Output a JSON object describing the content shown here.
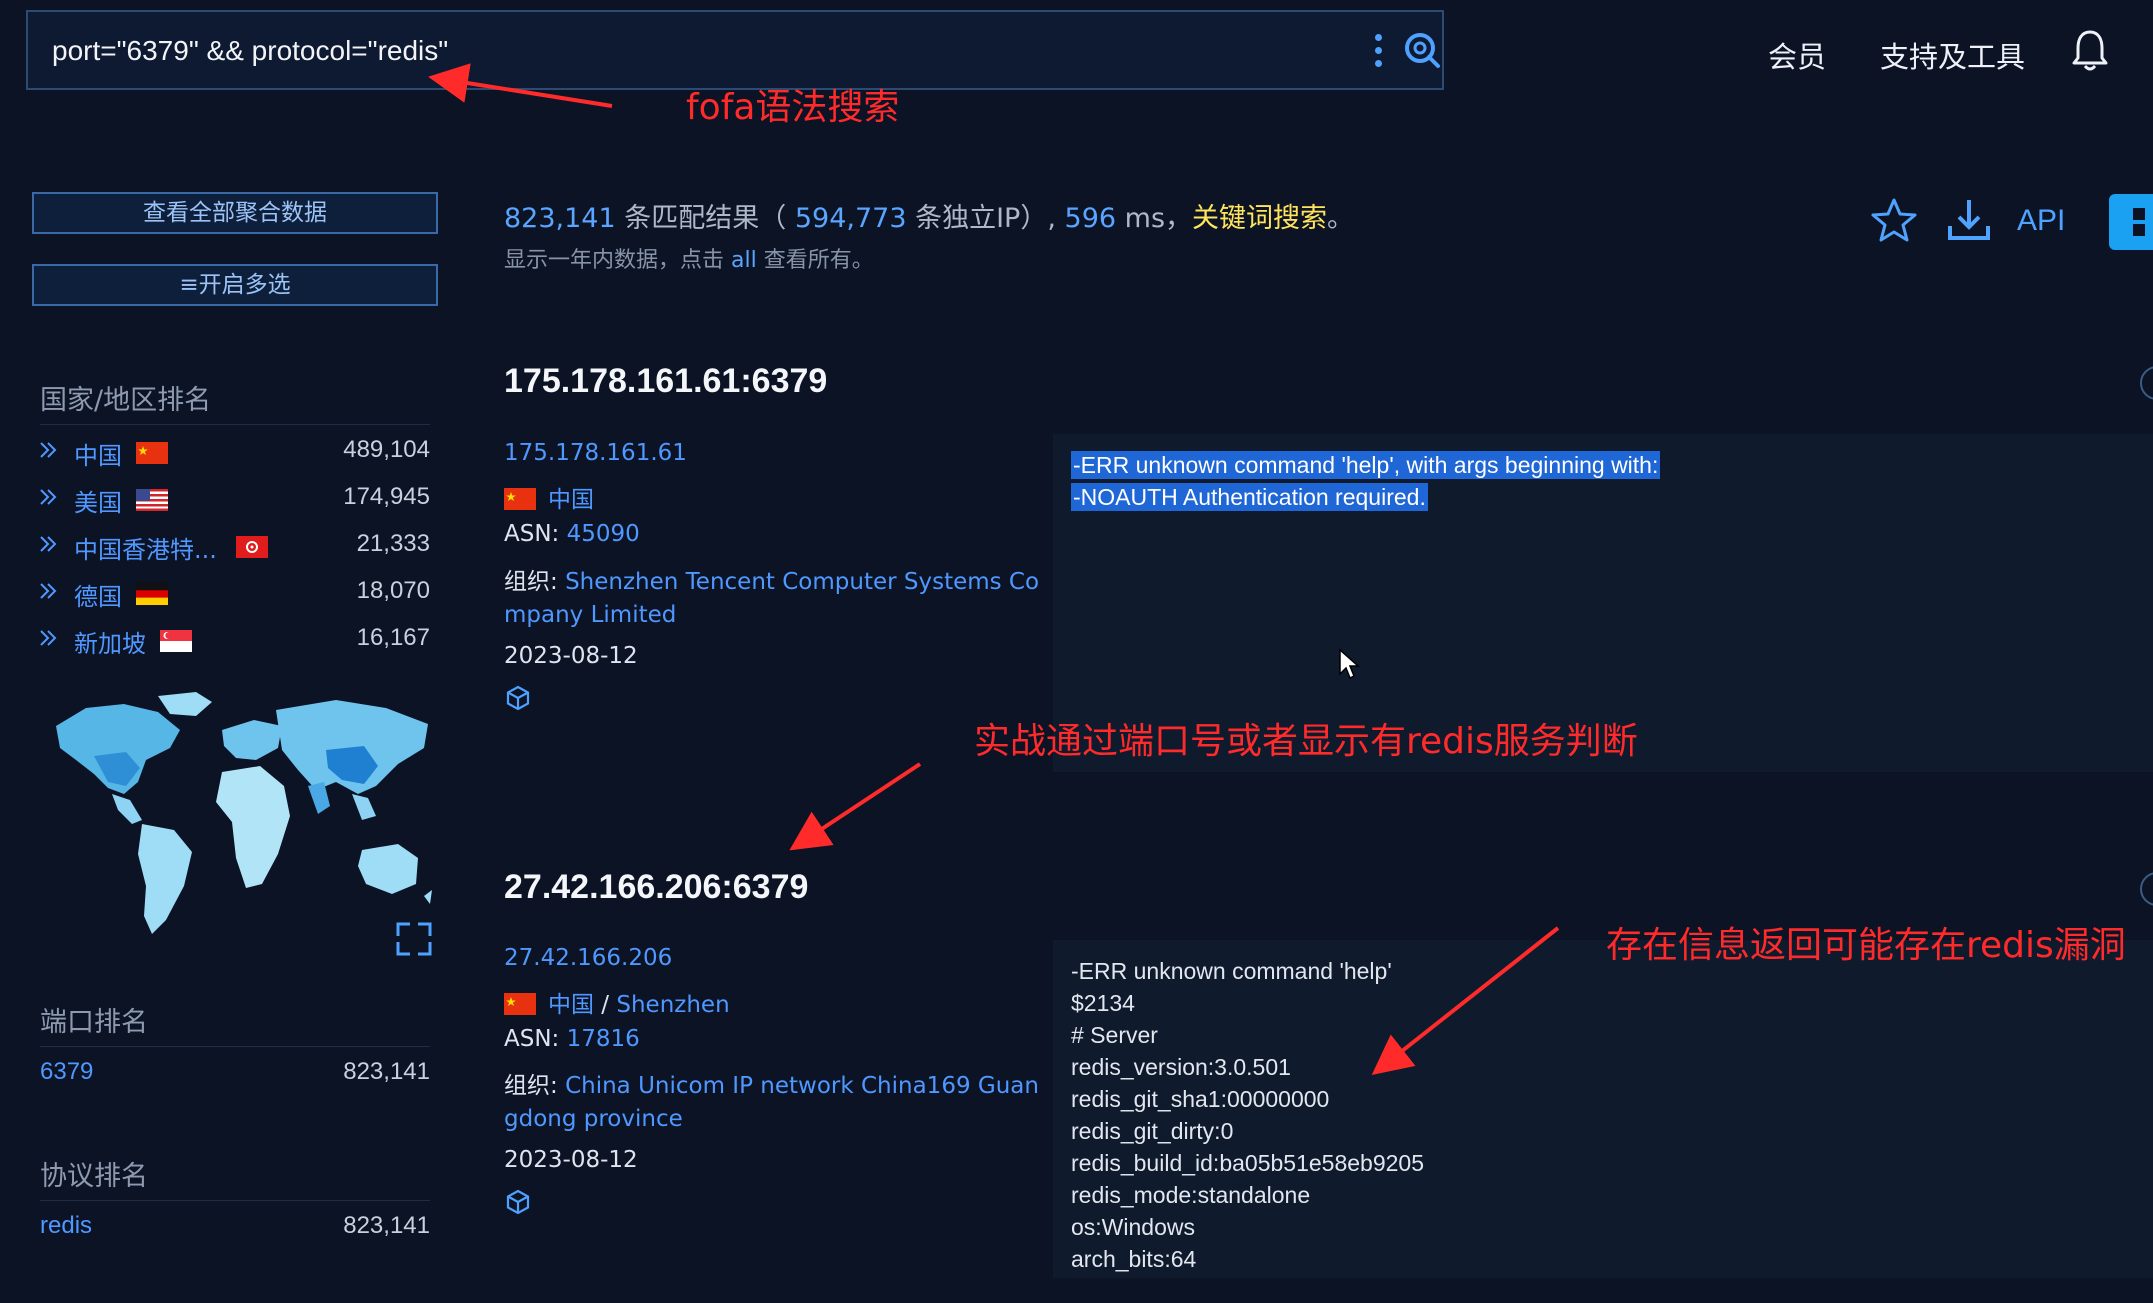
{
  "header": {
    "query": "port=\"6379\" && protocol=\"redis\"",
    "nav": [
      "会员",
      "支持及工具"
    ]
  },
  "annotations": {
    "search": "fofa语法搜索",
    "port_judge": "实战通过端口号或者显示有redis服务判断",
    "vuln": "存在信息返回可能存在redis漏洞"
  },
  "sidebar": {
    "agg_button": "查看全部聚合数据",
    "multi_button": "≡开启多选",
    "country_title": "国家/地区排名",
    "countries": [
      {
        "name": "中国",
        "count": "489,104"
      },
      {
        "name": "美国",
        "count": "174,945"
      },
      {
        "name": "中国香港特...",
        "count": "21,333"
      },
      {
        "name": "德国",
        "count": "18,070"
      },
      {
        "name": "新加坡",
        "count": "16,167"
      }
    ],
    "port_title": "端口排名",
    "port": {
      "label": "6379",
      "count": "823,141"
    },
    "protocol_title": "协议排名",
    "protocol": {
      "label": "redis",
      "count": "823,141"
    }
  },
  "summary": {
    "total": "823,141",
    "total_suffix": "条匹配结果（",
    "unique": "594,773",
    "unique_suffix": "条独立IP）,",
    "ms": "596",
    "ms_suffix": "ms，",
    "keyword": "关键词搜索",
    "end": "。",
    "line2_prefix": "显示一年内数据，点击",
    "line2_link": "all",
    "line2_suffix": "查看所有。",
    "api": "API"
  },
  "results": [
    {
      "title": "175.178.161.61:6379",
      "ip": "175.178.161.61",
      "country": "中国",
      "city": "",
      "asn_label": "ASN:",
      "asn": "45090",
      "org_label": "组织:",
      "org_line1": "Shenzhen Tencent Computer Systems Co",
      "org_line2": "mpany Limited",
      "date": "2023-08-12",
      "banner": [
        "-ERR unknown command 'help', with args beginning with:",
        "-NOAUTH Authentication required."
      ]
    },
    {
      "title": "27.42.166.206:6379",
      "ip": "27.42.166.206",
      "country": "中国",
      "city": "Shenzhen",
      "asn_label": "ASN:",
      "asn": "17816",
      "org_label": "组织:",
      "org_line1": "China Unicom IP network China169 Guan",
      "org_line2": "gdong province",
      "date": "2023-08-12",
      "banner": [
        "-ERR unknown command 'help'",
        "$2134",
        "# Server",
        "redis_version:3.0.501",
        "redis_git_sha1:00000000",
        "redis_git_dirty:0",
        "redis_build_id:ba05b51e58eb9205",
        "redis_mode:standalone",
        "os:Windows",
        "arch_bits:64"
      ]
    }
  ]
}
